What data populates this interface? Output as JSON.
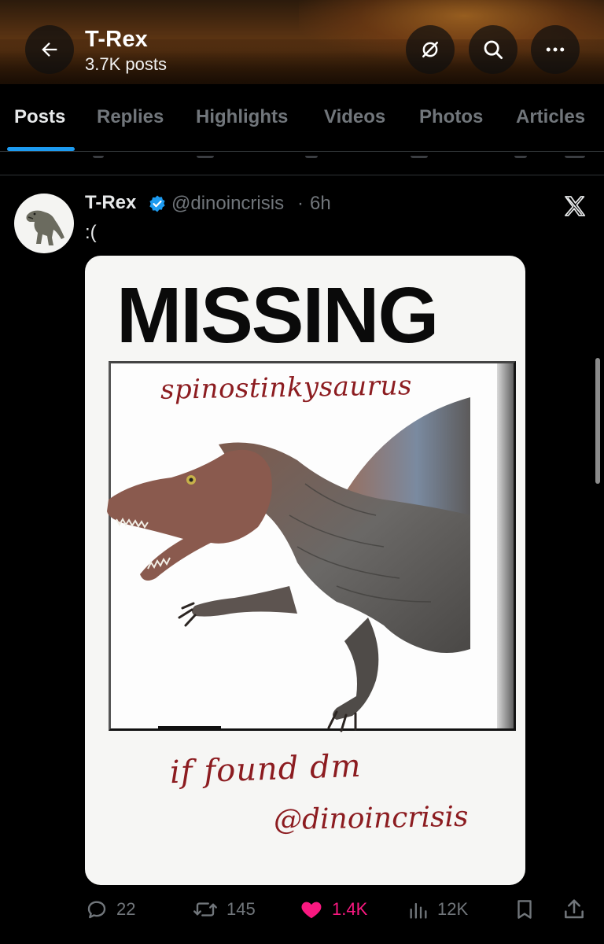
{
  "header": {
    "title": "T-Rex",
    "subtitle": "3.7K posts",
    "back_icon": "arrow-left-icon",
    "mute_icon": "notifications-off-icon",
    "search_icon": "search-icon",
    "more_icon": "more-dots-icon"
  },
  "tabs": [
    {
      "label": "Posts",
      "active": true
    },
    {
      "label": "Replies",
      "active": false
    },
    {
      "label": "Highlights",
      "active": false
    },
    {
      "label": "Videos",
      "active": false
    },
    {
      "label": "Photos",
      "active": false
    },
    {
      "label": "Articles",
      "active": false
    }
  ],
  "post": {
    "author_name": "T-Rex",
    "handle": "@dinoincrisis",
    "separator": "·",
    "time": "6h",
    "text": ":(",
    "media": {
      "headline": "MISSING",
      "name_note": "spinostinkysaurus",
      "found_note": "if found dm",
      "handle_note": "@dinoincrisis"
    },
    "actions": {
      "replies": "22",
      "reposts": "145",
      "likes": "1.4K",
      "views": "12K"
    }
  },
  "colors": {
    "accent": "#1d9bf0",
    "like": "#f91880",
    "muted_text": "#71767b",
    "handwriting": "#8c1c20"
  }
}
